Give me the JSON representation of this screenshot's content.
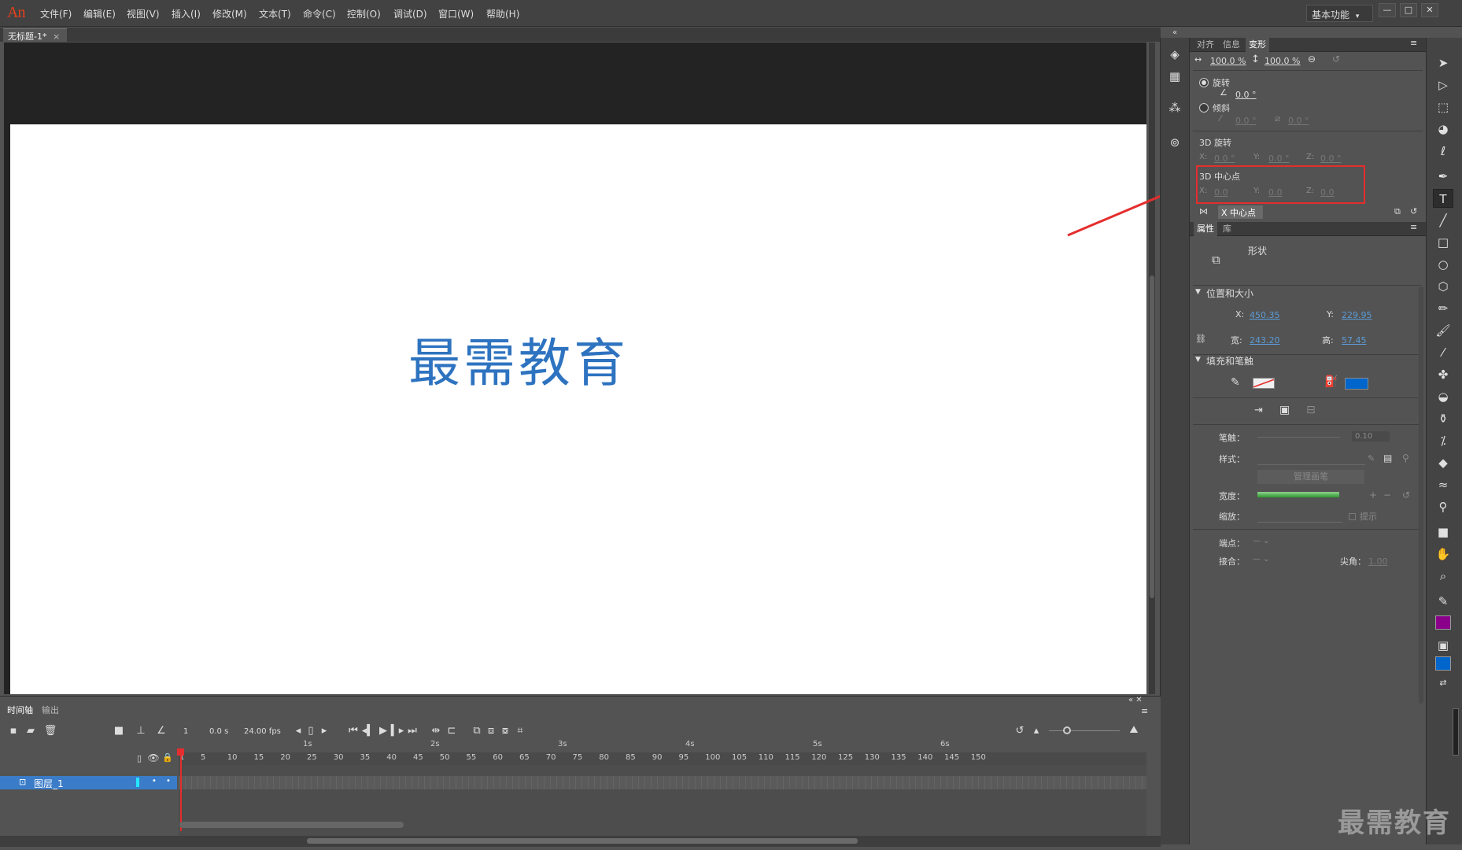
{
  "app": {
    "logo": "An",
    "menu": [
      "文件(F)",
      "编辑(E)",
      "视图(V)",
      "插入(I)",
      "修改(M)",
      "文本(T)",
      "命令(C)",
      "控制(O)",
      "调试(D)",
      "窗口(W)",
      "帮助(H)"
    ],
    "workspace": "基本功能",
    "workspace_arrow": "▾",
    "win_buttons": [
      "—",
      "□",
      "✕"
    ]
  },
  "document": {
    "tab_title": "无标题-1*",
    "tab_close": "×"
  },
  "stage": {
    "text": "最需教育",
    "text_color": "#2e73c0"
  },
  "transform_panel": {
    "tabs": [
      "对齐",
      "信息",
      "变形"
    ],
    "active_tab": "变形",
    "scale_w": "100.0 %",
    "scale_h": "100.0 %",
    "rotate_label": "旋转",
    "rotate_value": "0.0 °",
    "skew_label": "倾斜",
    "skew_h": "0.0 °",
    "skew_v": "0.0 °",
    "rot3d_label": "3D 旋转",
    "rot3d": {
      "x": "0.0 °",
      "y": "0.0 °",
      "z": "0.0 °"
    },
    "center3d_label": "3D 中心点",
    "center3d": {
      "x": "0.0",
      "y": "0.0",
      "z": "0.0"
    },
    "axis_labels": {
      "x": "X:",
      "y": "Y:",
      "z": "Z:"
    },
    "center_chip": "X 中心点"
  },
  "properties_panel": {
    "tabs": [
      "属性",
      "库"
    ],
    "active_tab": "属性",
    "object_type": "形状",
    "pos_size_header": "位置和大小",
    "x_label": "X:",
    "x": "450.35",
    "y_label": "Y:",
    "y": "229.95",
    "w_label": "宽:",
    "w": "243.20",
    "h_label": "高:",
    "h": "57.45",
    "fill_stroke_header": "填充和笔触",
    "fill_color": "#0066cc",
    "stroke_label": "笔触：",
    "stroke_value": "0.10",
    "style_label": "样式：",
    "manage_brush": "管理画笔",
    "width_label": "宽度：",
    "scale_label": "缩放：",
    "hint_label": "提示",
    "cap_label": "端点：",
    "join_label": "接合：",
    "miter_label": "尖角：",
    "miter_value": "1.00"
  },
  "tools": {
    "fill_color": "#8b008b",
    "stroke_color": "#0066cc"
  },
  "timeline": {
    "tabs": [
      "时间轴",
      "输出"
    ],
    "active_tab": "时间轴",
    "frame_no": "1",
    "time": "0.0 s",
    "fps": "24.00 fps",
    "seconds": [
      "1s",
      "2s",
      "3s",
      "4s",
      "5s",
      "6s"
    ],
    "frame_numbers": [
      "1",
      "5",
      "10",
      "15",
      "20",
      "25",
      "30",
      "35",
      "40",
      "45",
      "50",
      "55",
      "60",
      "65",
      "70",
      "75",
      "80",
      "85",
      "90",
      "95",
      "100",
      "105",
      "110",
      "115",
      "120",
      "125",
      "130",
      "135",
      "140",
      "145",
      "150"
    ],
    "layer_name": "图层_1"
  },
  "watermark": "最需教育"
}
